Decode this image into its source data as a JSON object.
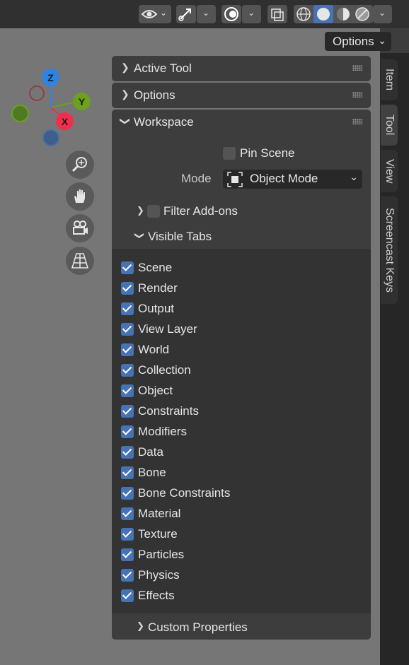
{
  "header": {
    "options_label": "Options"
  },
  "gizmo": {
    "z": "Z",
    "y": "Y",
    "x": "X",
    "colors": {
      "z": "#2f84e3",
      "y": "#6ca01f",
      "x": "#f02f4f",
      "neg": "#9a3b45"
    }
  },
  "nav_icons": [
    "zoom-icon",
    "pan-hand-icon",
    "camera-icon",
    "perspective-grid-icon"
  ],
  "sidebar_tabs": [
    "Item",
    "Tool",
    "View",
    "Screencast Keys"
  ],
  "panels": {
    "active_tool": "Active Tool",
    "options": "Options",
    "workspace": "Workspace"
  },
  "workspace": {
    "pin_scene": "Pin Scene",
    "mode_label": "Mode",
    "mode_value": "Object Mode",
    "filter_addons": "Filter Add-ons",
    "visible_tabs": "Visible Tabs",
    "custom_properties": "Custom Properties",
    "tabs": [
      {
        "label": "Scene",
        "checked": true
      },
      {
        "label": "Render",
        "checked": true
      },
      {
        "label": "Output",
        "checked": true
      },
      {
        "label": "View Layer",
        "checked": true
      },
      {
        "label": "World",
        "checked": true
      },
      {
        "label": "Collection",
        "checked": true
      },
      {
        "label": "Object",
        "checked": true
      },
      {
        "label": "Constraints",
        "checked": true
      },
      {
        "label": "Modifiers",
        "checked": true
      },
      {
        "label": "Data",
        "checked": true
      },
      {
        "label": "Bone",
        "checked": true
      },
      {
        "label": "Bone Constraints",
        "checked": true
      },
      {
        "label": "Material",
        "checked": true
      },
      {
        "label": "Texture",
        "checked": true
      },
      {
        "label": "Particles",
        "checked": true
      },
      {
        "label": "Physics",
        "checked": true
      },
      {
        "label": "Effects",
        "checked": true
      }
    ]
  },
  "colors": {
    "accent": "#4772b3",
    "viewport": "#767676",
    "panel": "#3d3d3d"
  }
}
